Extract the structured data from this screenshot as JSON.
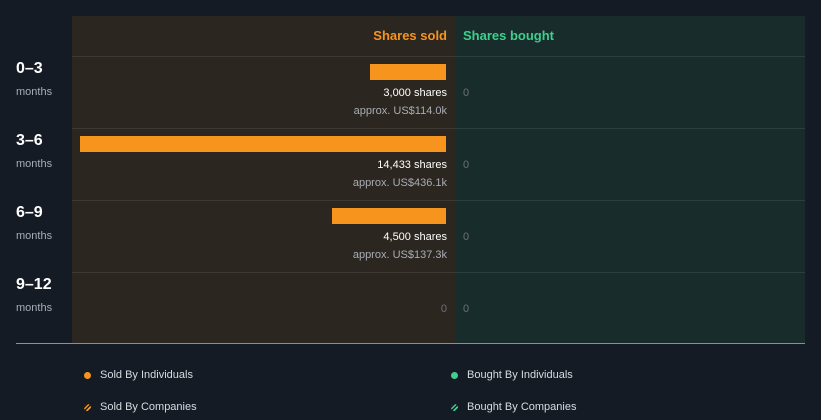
{
  "chart_data": {
    "type": "bar",
    "orientation": "horizontal",
    "categories": [
      {
        "period": "0–3",
        "unit": "months"
      },
      {
        "period": "3–6",
        "unit": "months"
      },
      {
        "period": "6–9",
        "unit": "months"
      },
      {
        "period": "9–12",
        "unit": "months"
      }
    ],
    "series": [
      {
        "name": "Shares sold",
        "values": [
          3000,
          14433,
          4500,
          0
        ],
        "labels": [
          "3,000 shares",
          "14,433 shares",
          "4,500 shares",
          "0"
        ],
        "approx": [
          "approx. US$114.0k",
          "approx. US$436.1k",
          "approx. US$137.3k",
          ""
        ]
      },
      {
        "name": "Shares bought",
        "values": [
          0,
          0,
          0,
          0
        ],
        "labels": [
          "0",
          "0",
          "0",
          "0"
        ]
      }
    ],
    "xlim": [
      0,
      14433
    ],
    "legend": [
      {
        "label": "Sold By Individuals",
        "color": "#f7941d",
        "style": "solid"
      },
      {
        "label": "Bought By Individuals",
        "color": "#3ecf8e",
        "style": "solid"
      },
      {
        "label": "Sold By Companies",
        "color": "#f7941d",
        "style": "hatched"
      },
      {
        "label": "Bought By Companies",
        "color": "#3ecf8e",
        "style": "hatched"
      }
    ],
    "colors": {
      "sold": "#f7941d",
      "bought": "#3ecf8e"
    }
  }
}
